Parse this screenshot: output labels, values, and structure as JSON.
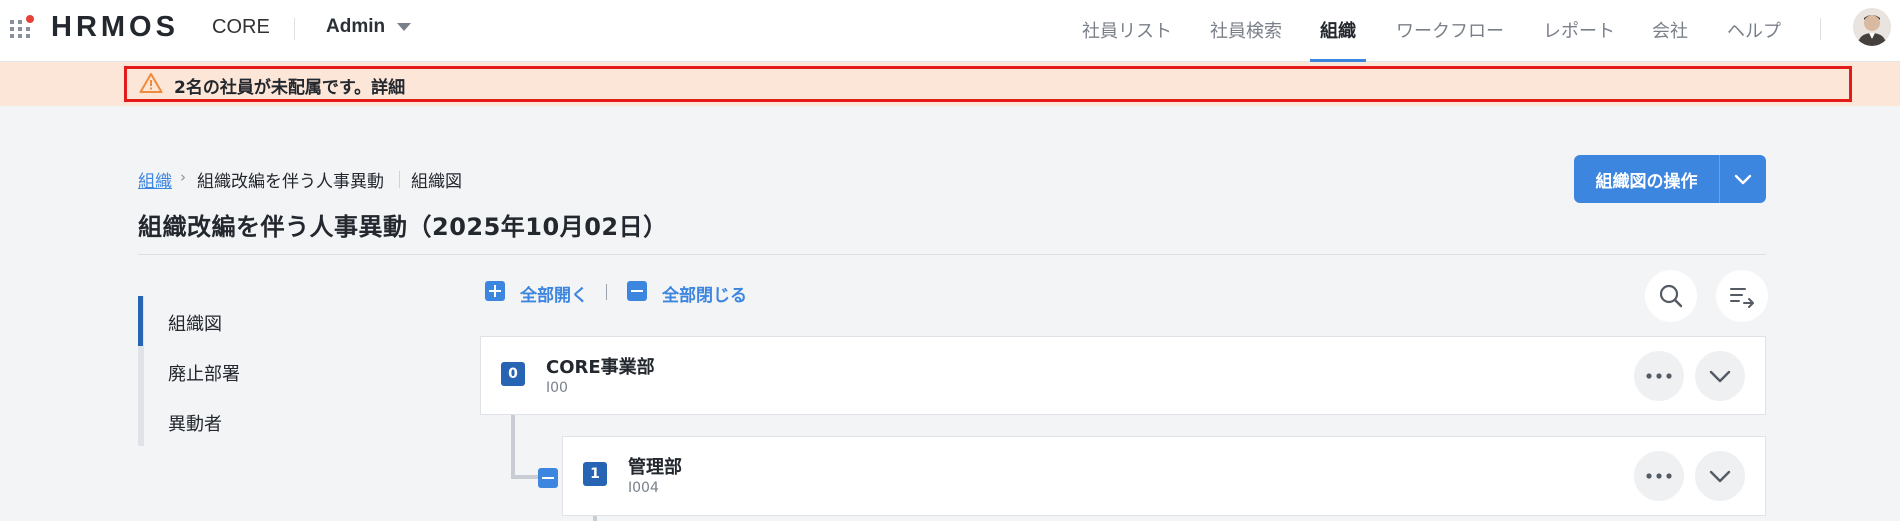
{
  "header": {
    "logo_text": "HRMOS",
    "product": "CORE",
    "role": "Admin",
    "nav": [
      {
        "label": "社員リスト",
        "active": false
      },
      {
        "label": "社員検索",
        "active": false
      },
      {
        "label": "組織",
        "active": true
      },
      {
        "label": "ワークフロー",
        "active": false
      },
      {
        "label": "レポート",
        "active": false
      },
      {
        "label": "会社",
        "active": false
      },
      {
        "label": "ヘルプ",
        "active": false
      }
    ],
    "accent_color": "#3d86e0"
  },
  "alert": {
    "icon": "warning-triangle-icon",
    "text": "2名の社員が未配属です。詳細",
    "background": "#fce6d7"
  },
  "breadcrumb": {
    "root": "組織",
    "middle": "組織改編を伴う人事異動",
    "current": "組織図"
  },
  "page": {
    "title": "組織改編を伴う人事異動（2025年10月02日）",
    "ops_button": "組織図の操作"
  },
  "side_nav": {
    "items": [
      "組織図",
      "廃止部署",
      "異動者"
    ],
    "active_index": 0
  },
  "toolbar": {
    "expand_all": "全部開く",
    "collapse_all": "全部閉じる"
  },
  "tree": [
    {
      "level": "0",
      "name": "CORE事業部",
      "code": "I00"
    },
    {
      "level": "1",
      "name": "管理部",
      "code": "I004"
    }
  ]
}
